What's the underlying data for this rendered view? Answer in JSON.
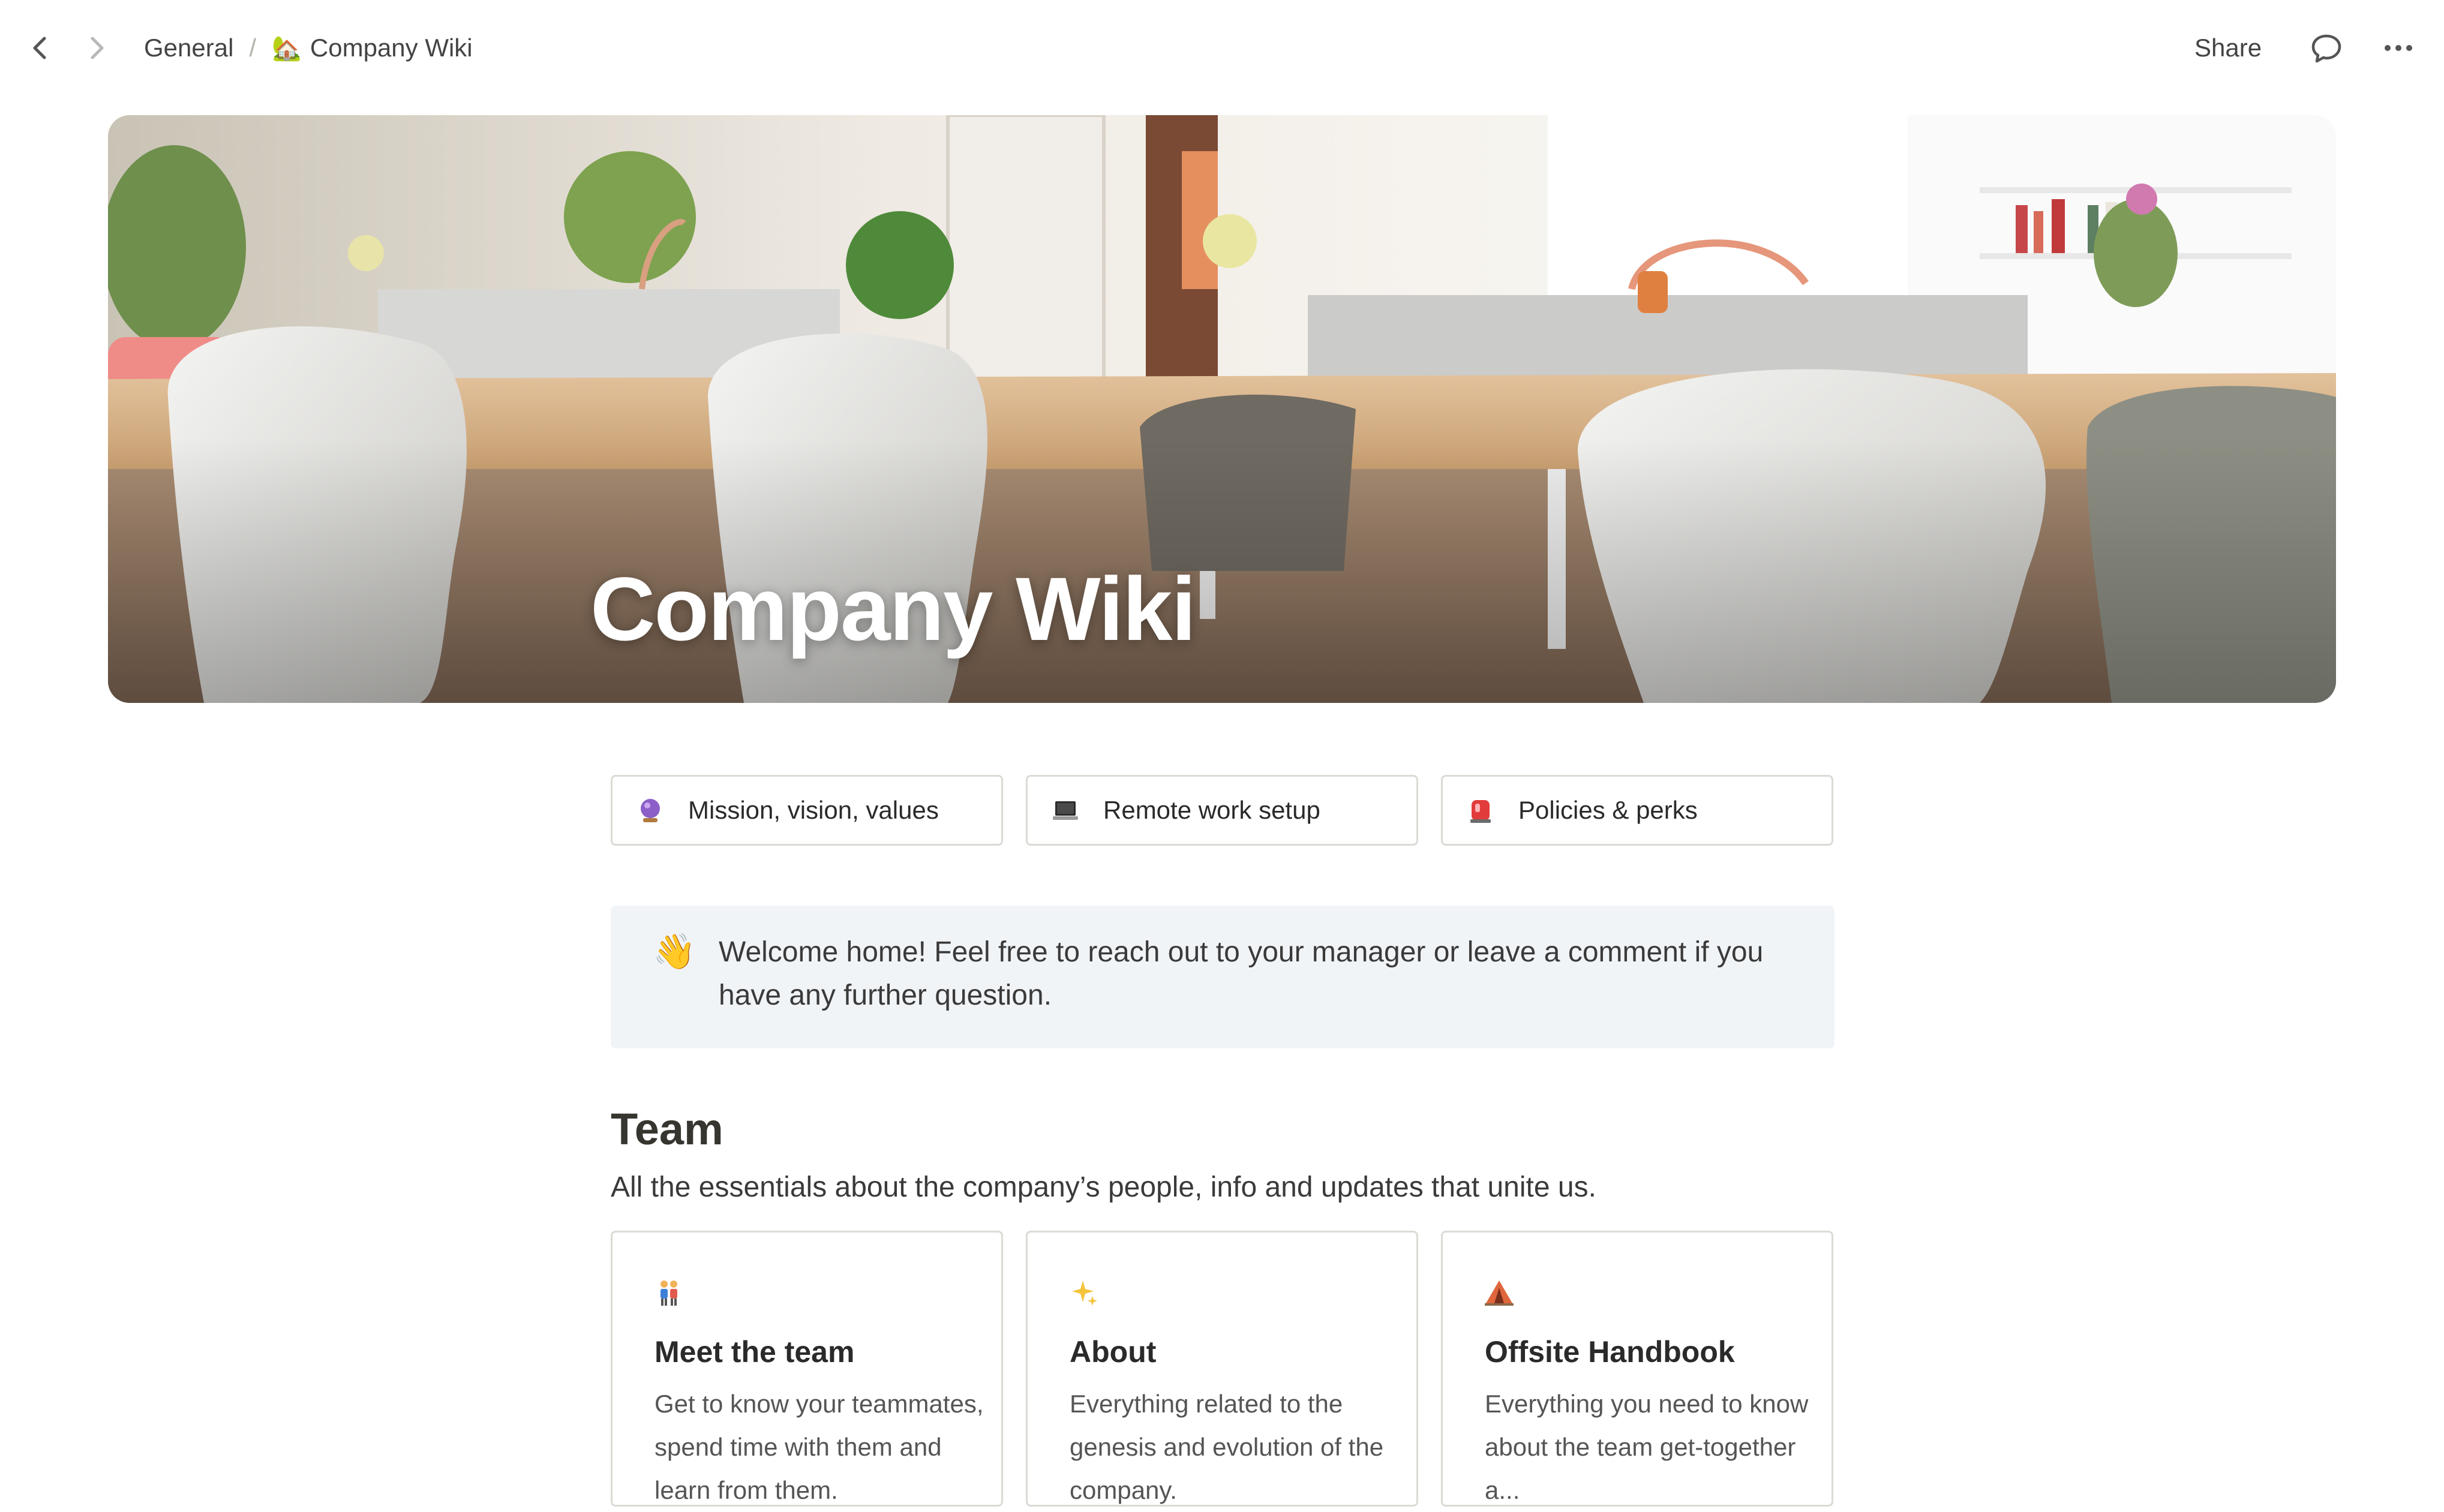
{
  "topbar": {
    "breadcrumb": [
      {
        "label": "General"
      },
      {
        "emoji": "🏡",
        "label": "Company Wiki"
      }
    ],
    "share_label": "Share",
    "icons": [
      "back-arrow-icon",
      "forward-arrow-icon",
      "comment-icon",
      "more-icon"
    ]
  },
  "cover": {
    "title": "Company Wiki"
  },
  "quick_links": [
    {
      "emoji": "🔮",
      "label": "Mission, vision, values"
    },
    {
      "emoji": "💻",
      "label": "Remote work setup"
    },
    {
      "emoji": "🚨",
      "label": "Policies & perks"
    }
  ],
  "callout": {
    "emoji": "👋",
    "text": "Welcome home! Feel free to reach out to your manager or leave a comment if you have any further question."
  },
  "team": {
    "heading": "Team",
    "subheading": "All the essentials about the company’s people, info and updates that unite us.",
    "cards": [
      {
        "emoji": "👫",
        "title": "Meet the team",
        "description": "Get to know your teammates, spend time with them and learn from them."
      },
      {
        "emoji": "✨",
        "title": "About",
        "description": "Everything related to the genesis and evolution of the company."
      },
      {
        "emoji": "⛺",
        "title": "Offsite Handbook",
        "description": "Everything you need to know about the team get-together a..."
      }
    ]
  },
  "colors": {
    "text": "#37352f",
    "muted": "#555555",
    "border": "#dcdad5",
    "callout_bg": "#f1f4f7"
  }
}
